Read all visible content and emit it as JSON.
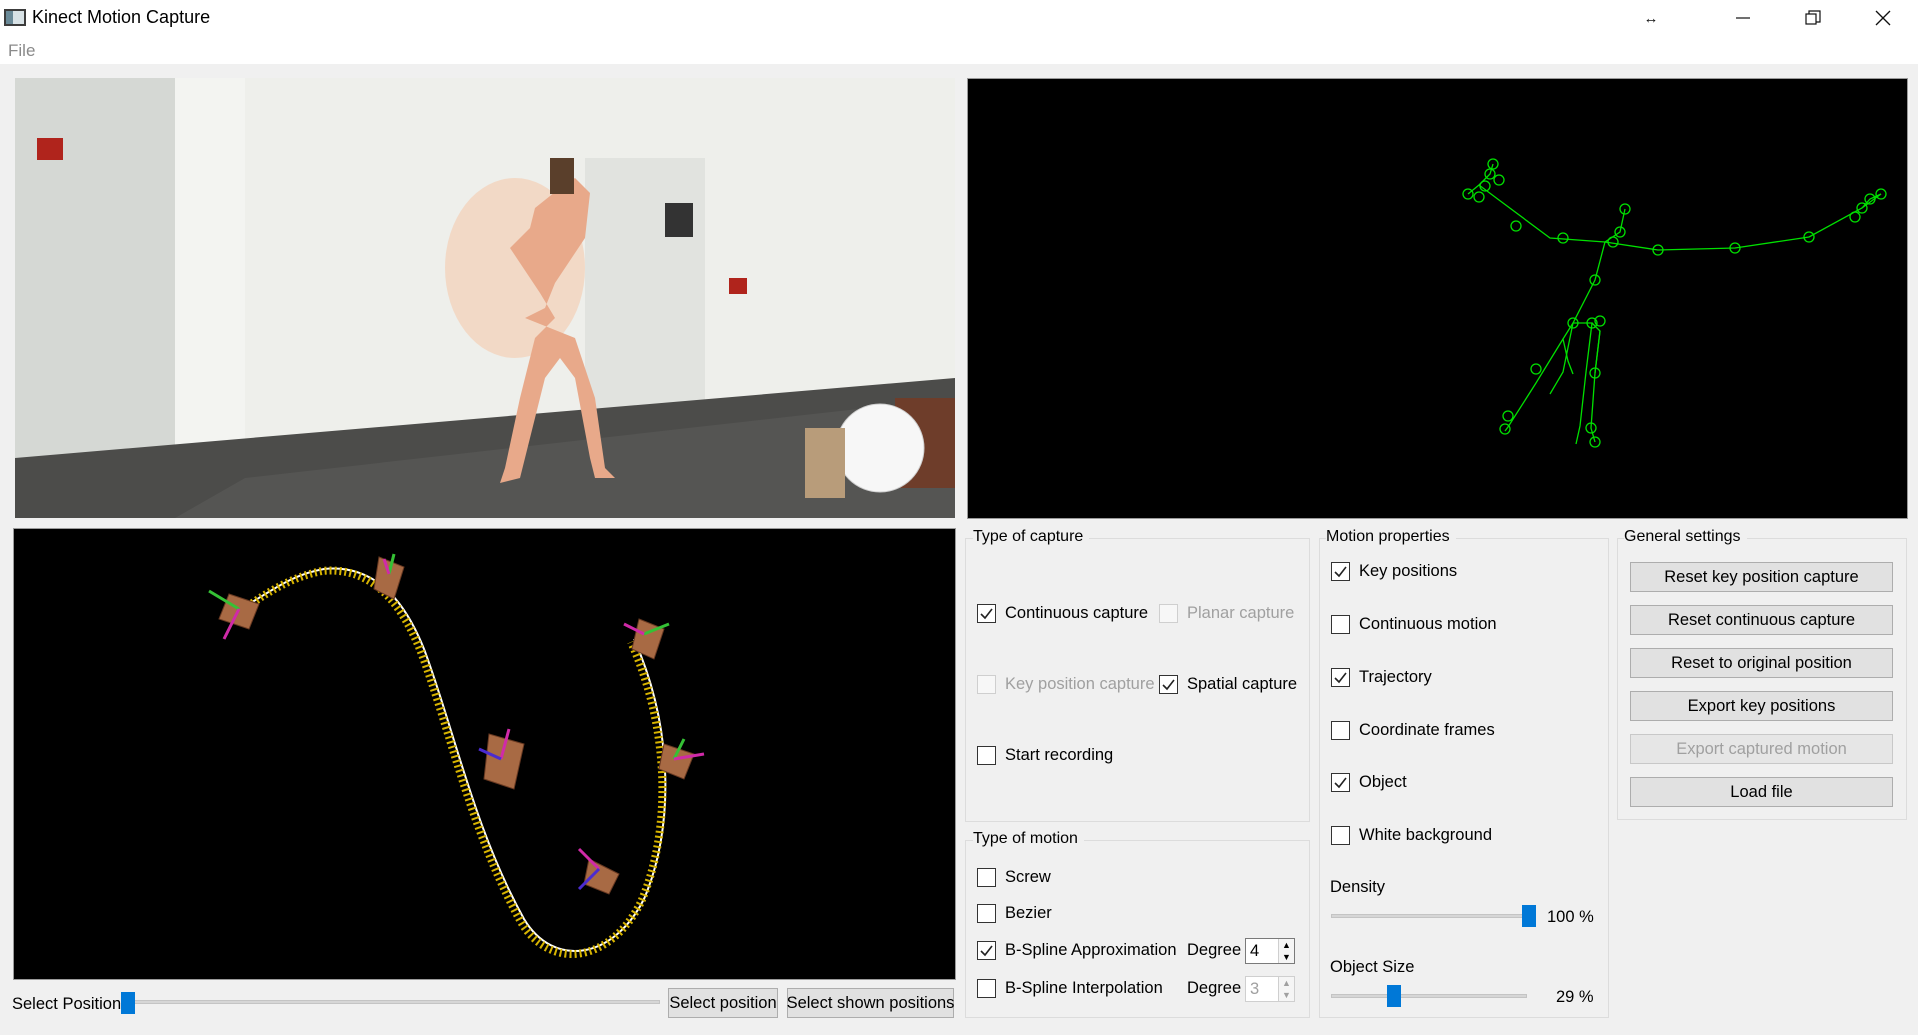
{
  "window": {
    "title": "Kinect Motion Capture"
  },
  "menu": {
    "file": "File"
  },
  "position_bar": {
    "label": "Select Position",
    "select_position_button": "Select position",
    "select_shown_button": "Select shown positions"
  },
  "capture_group": {
    "title": "Type of capture",
    "continuous": {
      "label": "Continuous capture",
      "checked": true
    },
    "planar": {
      "label": "Planar capture",
      "checked": false,
      "disabled": true
    },
    "key_position": {
      "label": "Key position capture",
      "checked": false,
      "disabled": true
    },
    "spatial": {
      "label": "Spatial capture",
      "checked": true
    },
    "start_recording": {
      "label": "Start recording",
      "checked": false
    }
  },
  "motion_type_group": {
    "title": "Type of motion",
    "screw": {
      "label": "Screw",
      "checked": false
    },
    "bezier": {
      "label": "Bezier",
      "checked": false
    },
    "bspline_approx": {
      "label": "B-Spline Approximation",
      "checked": true,
      "degree_label": "Degree",
      "degree_value": "4"
    },
    "bspline_interp": {
      "label": "B-Spline Interpolation",
      "checked": false,
      "degree_label": "Degree",
      "degree_value": "3"
    }
  },
  "motion_props_group": {
    "title": "Motion properties",
    "key_positions": {
      "label": "Key positions",
      "checked": true
    },
    "continuous_motion": {
      "label": "Continuous motion",
      "checked": false
    },
    "trajectory": {
      "label": "Trajectory",
      "checked": true
    },
    "coordinate_frames": {
      "label": "Coordinate frames",
      "checked": false
    },
    "object": {
      "label": "Object",
      "checked": true
    },
    "white_background": {
      "label": "White background",
      "checked": false
    },
    "density": {
      "label": "Density",
      "value_text": "100 %",
      "value": 100
    },
    "object_size": {
      "label": "Object Size",
      "value_text": "29 %",
      "value": 29
    }
  },
  "general_group": {
    "title": "General settings",
    "buttons": [
      {
        "label": "Reset key position capture",
        "disabled": false
      },
      {
        "label": "Reset continuous capture",
        "disabled": false
      },
      {
        "label": "Reset to original position",
        "disabled": false
      },
      {
        "label": "Export key positions",
        "disabled": false
      },
      {
        "label": "Export captured motion",
        "disabled": true
      },
      {
        "label": "Load file",
        "disabled": false
      }
    ]
  },
  "icons": {
    "window": "app-window-icon",
    "resize": "resize-arrows-icon",
    "minimize": "minimize-icon",
    "restore": "restore-icon",
    "close": "close-icon"
  },
  "colors": {
    "skeleton": "#00e000",
    "slider_thumb": "#0078d7",
    "trajectory": "#d7b400",
    "object": "#a86a44"
  }
}
